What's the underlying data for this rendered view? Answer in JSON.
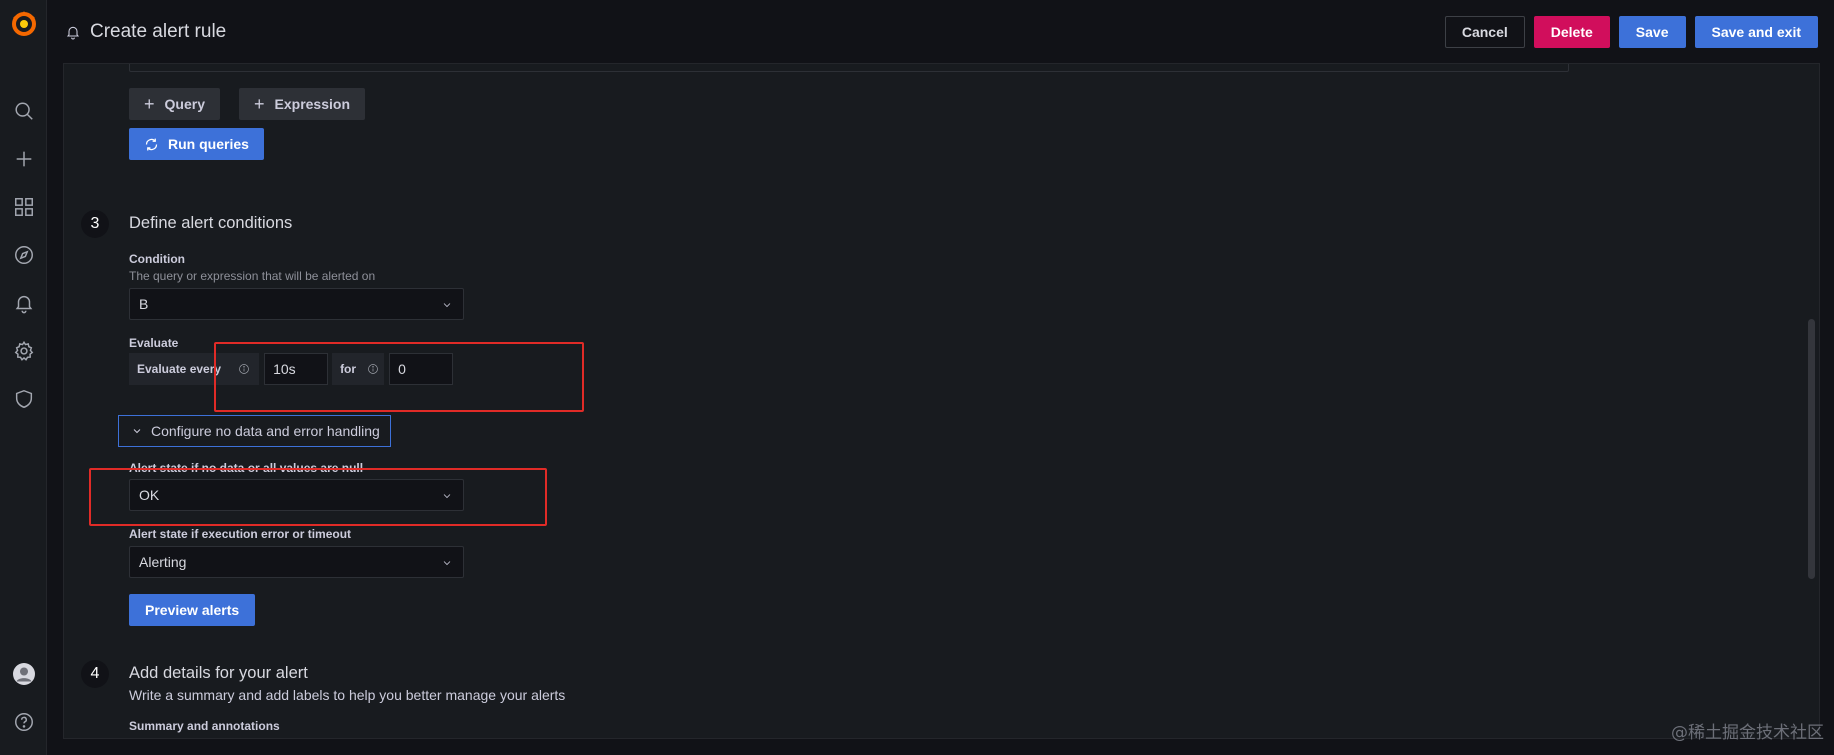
{
  "sidebar": {
    "logo": "grafana-logo",
    "items": [
      {
        "name": "search",
        "icon": "search-icon"
      },
      {
        "name": "create",
        "icon": "plus-icon"
      },
      {
        "name": "dashboards",
        "icon": "apps-icon"
      },
      {
        "name": "explore",
        "icon": "compass-icon"
      },
      {
        "name": "alerting",
        "icon": "bell-icon"
      },
      {
        "name": "configuration",
        "icon": "gear-icon"
      },
      {
        "name": "server-admin",
        "icon": "shield-icon"
      }
    ],
    "bottom": [
      {
        "name": "profile",
        "icon": "avatar-icon"
      },
      {
        "name": "help",
        "icon": "help-icon"
      }
    ]
  },
  "header": {
    "title": "Create alert rule",
    "icon": "bell-icon",
    "buttons": {
      "cancel": "Cancel",
      "delete": "Delete",
      "save": "Save",
      "save_exit": "Save and exit"
    }
  },
  "queries": {
    "add_query": "Query",
    "add_expression": "Expression",
    "run_queries": "Run queries"
  },
  "step3": {
    "number": "3",
    "title": "Define alert conditions",
    "condition": {
      "label": "Condition",
      "description": "The query or expression that will be alerted on",
      "value": "B"
    },
    "evaluate": {
      "label": "Evaluate",
      "every_label": "Evaluate every",
      "every_value": "10s",
      "for_label": "for",
      "for_value": "0"
    },
    "configure_toggle": "Configure no data and error handling",
    "no_data": {
      "label": "Alert state if no data or all values are null",
      "value": "OK"
    },
    "exec_error": {
      "label": "Alert state if execution error or timeout",
      "value": "Alerting"
    },
    "preview": "Preview alerts"
  },
  "step4": {
    "number": "4",
    "title": "Add details for your alert",
    "description": "Write a summary and add labels to help you better manage your alerts",
    "summary_label": "Summary and annotations"
  },
  "watermark": "@稀土掘金技术社区",
  "colors": {
    "primary": "#3d71d9",
    "danger": "#d10e5c",
    "highlight": "#e02b27"
  }
}
